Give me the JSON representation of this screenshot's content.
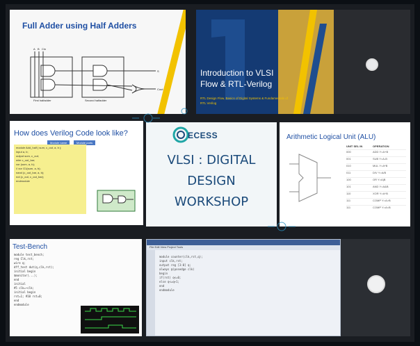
{
  "panels": {
    "full_adder": {
      "title": "Full Adder using Half Adders",
      "labels": [
        "A",
        "B",
        "Cin",
        "First halfadder",
        "Second halfadder",
        "S",
        "Cout"
      ]
    },
    "intro": {
      "title_line1": "Introduction to VLSI",
      "title_line2": "Flow & RTL-Verilog",
      "subtitle": "RTL Design Flow, Basics of Digital Systems & Fundamentals of RTL Verilog"
    },
    "verilog": {
      "title": "How does Verilog Code look like?",
      "badges": [
        "Module name",
        "Module ports"
      ],
      "code_lines": [
        "module Add_half ( sum, c_out, a, b );",
        "  input  a, b;",
        "  output sum, c_out;",
        "  wire   c_out_bar;",
        "",
        "  xor (sum, a, b);",
        "  // xor G1(sum, a, b);",
        "  nand (c_out_bar, a, b);",
        "  not (c_out, c_out_bar);",
        "endmodule"
      ]
    },
    "workshop": {
      "logo_text": "ECESS",
      "line1": "VLSI : DIGITAL",
      "line2": "DESIGN",
      "line3": "WORKSHOP"
    },
    "alu": {
      "title": "Arithmetic Logical Unit (ALU)",
      "col1_header": "UNIT SEL IN",
      "col2_header": "OPERATION",
      "rows": [
        [
          "000",
          "ADD Y=A+B"
        ],
        [
          "001",
          "SUB Y=A-B"
        ],
        [
          "010",
          "MUL Y=A*B"
        ],
        [
          "011",
          "DIV Y=A/B"
        ],
        [
          "100",
          "OR Y=A|B"
        ],
        [
          "101",
          "AND Y=A&B"
        ],
        [
          "110",
          "XOR Y=A^B"
        ],
        [
          "111",
          "COMP Y=A>B"
        ],
        [
          "111",
          "COMP Y=A<B"
        ]
      ]
    },
    "testbench": {
      "title": "Test-Bench",
      "code_lines": [
        "module test_bench;",
        "  reg  Clk,rst;",
        "  wire q;",
        "  dff_test dut(q,clk,rst);",
        "  initial begin",
        "    $monitor(...);",
        "  end",
        "  initial",
        "    #5 clk=~clk;",
        "  initial begin",
        "    rst=1; #10 rst=0;",
        "  end",
        "endmodule"
      ]
    },
    "editor": {
      "menu": "File Edit View Project Tools",
      "lines": [
        "module counter(clk,rst,q);",
        "input clk,rst;",
        "output reg [3:0] q;",
        "always @(posedge clk)",
        "begin",
        "if(rst) q<=0;",
        "else q<=q+1;",
        "end",
        "endmodule"
      ]
    }
  },
  "colors": {
    "accent_blue": "#1f4fa3",
    "accent_yellow": "#f2c200",
    "intro_bg": "#143a73",
    "workshop_text": "#1b4a7a"
  }
}
